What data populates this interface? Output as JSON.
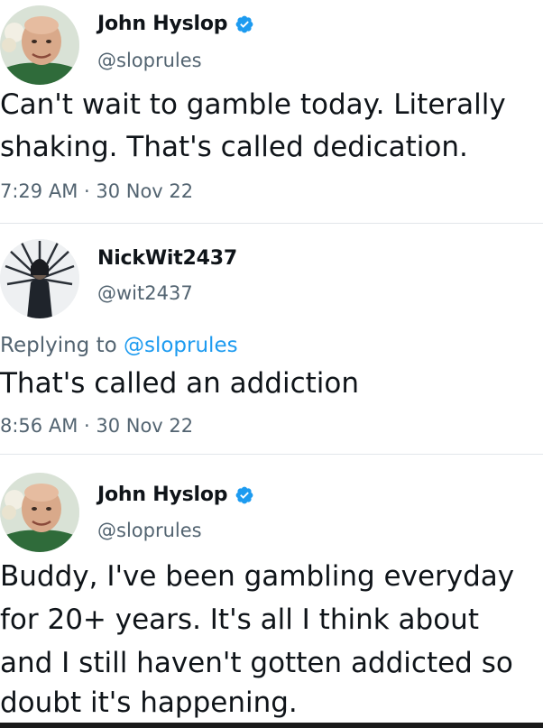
{
  "tweets": [
    {
      "name": "John Hyslop",
      "handle": "@sloprules",
      "verified": true,
      "text_lines": [
        "Can't wait to gamble today. Literally",
        "shaking. That's called dedication."
      ],
      "meta": "7:29 AM · 30 Nov 22"
    },
    {
      "name": "NickWit2437",
      "handle": "@wit2437",
      "verified": false,
      "replying_prefix": "Replying to ",
      "replying_mention": "@sloprules",
      "text_lines": [
        "That's called an addiction"
      ],
      "meta": "8:56 AM · 30 Nov 22"
    },
    {
      "name": "John Hyslop",
      "handle": "@sloprules",
      "verified": true,
      "text_lines": [
        "Buddy, I've been gambling everyday",
        "for 20+ years. It's all I think about",
        "and I still haven't gotten addicted so",
        "doubt it's happening."
      ]
    }
  ],
  "colors": {
    "verified_blue": "#1d9bf0",
    "secondary_text": "#536471",
    "link": "#1d9bf0"
  },
  "icons": {
    "verified": "verified-badge-icon"
  }
}
